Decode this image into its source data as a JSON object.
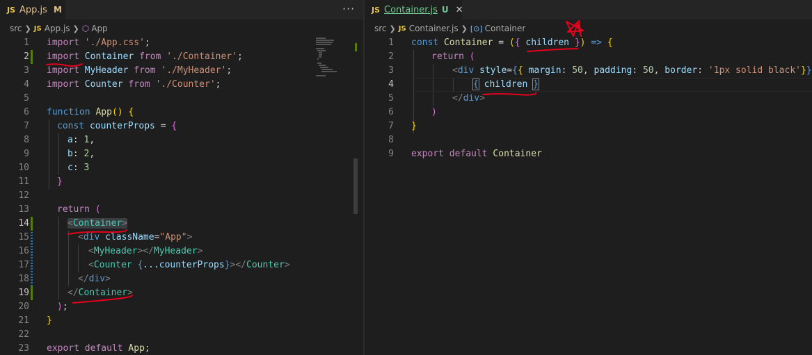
{
  "left_tab": {
    "badge": "JS",
    "title": "App.js",
    "status": "M",
    "more": "···"
  },
  "right_tab": {
    "badge": "JS",
    "title": "Container.js",
    "status": "U",
    "close": "✕"
  },
  "left_breadcrumb": {
    "folder": "src",
    "badge": "JS",
    "file": "App.js",
    "symbol": "App"
  },
  "right_breadcrumb": {
    "folder": "src",
    "badge": "JS",
    "file": "Container.js",
    "symbol": "Container"
  },
  "left_code": {
    "line_numbers": [
      "1",
      "2",
      "3",
      "4",
      "5",
      "6",
      "7",
      "8",
      "9",
      "10",
      "11",
      "12",
      "13",
      "14",
      "15",
      "16",
      "17",
      "18",
      "19",
      "20",
      "21",
      "22",
      "23"
    ],
    "l1": [
      "import",
      "'./App.css'",
      ";"
    ],
    "l2": [
      "import",
      "Container",
      "from",
      "'./Container'",
      ";"
    ],
    "l3": [
      "import",
      "MyHeader",
      "from",
      "'./MyHeader'",
      ";"
    ],
    "l4": [
      "import",
      "Counter",
      "from",
      "'./Counter'",
      ";"
    ],
    "l6": [
      "function",
      "App",
      "()",
      "{"
    ],
    "l7": [
      "const",
      "counterProps",
      "=",
      "{"
    ],
    "l8": [
      "a",
      ":",
      "1",
      ","
    ],
    "l9": [
      "b",
      ":",
      "2",
      ","
    ],
    "l10": [
      "c",
      ":",
      "3"
    ],
    "l11": [
      "}"
    ],
    "l13": [
      "return",
      "("
    ],
    "l14": [
      "<",
      "Container",
      ">"
    ],
    "l15": [
      "<",
      "div",
      "className",
      "=",
      "\"App\"",
      ">"
    ],
    "l16": [
      "<",
      "MyHeader",
      "></",
      "MyHeader",
      ">"
    ],
    "l17": [
      "<",
      "Counter",
      "{",
      "...counterProps",
      "}",
      "></",
      "Counter",
      ">"
    ],
    "l18": [
      "</",
      "div",
      ">"
    ],
    "l19": [
      "</",
      "Container",
      ">"
    ],
    "l20": [
      ")",
      ";"
    ],
    "l21": [
      "}"
    ],
    "l23": [
      "export",
      "default",
      "App",
      ";"
    ]
  },
  "right_code": {
    "line_numbers": [
      "1",
      "2",
      "3",
      "4",
      "5",
      "6",
      "7",
      "8",
      "9"
    ],
    "l1": [
      "const",
      "Container",
      "=",
      "(",
      "{",
      "children",
      "}",
      ")",
      "=>",
      "{"
    ],
    "l2": [
      "return",
      "("
    ],
    "l3": [
      "<",
      "div",
      "style",
      "=",
      "{",
      "{",
      "margin",
      ":",
      "50",
      ",",
      "padding",
      ":",
      "50",
      ",",
      "border",
      ":",
      "'1px solid black'",
      "}",
      "}",
      ">"
    ],
    "l4": [
      "{",
      "children",
      "}"
    ],
    "l5": [
      "</",
      "div",
      ">"
    ],
    "l6": [
      ")"
    ],
    "l7": [
      "}"
    ],
    "l9": [
      "export",
      "default",
      "Container"
    ]
  },
  "colors": {
    "background": "#1e1e1e",
    "tabbar": "#252526",
    "keyword": "#569cd6",
    "control": "#c586c0",
    "string": "#ce9178",
    "number": "#b5cea8",
    "variable": "#9cdcfe",
    "function": "#dcdcaa",
    "component": "#4ec9b0",
    "annotation": "#e8001c"
  },
  "icons": {
    "symbol_method": "cube-icon",
    "symbol_variable": "variable-icon",
    "more": "ellipsis-icon",
    "close": "close-icon"
  }
}
